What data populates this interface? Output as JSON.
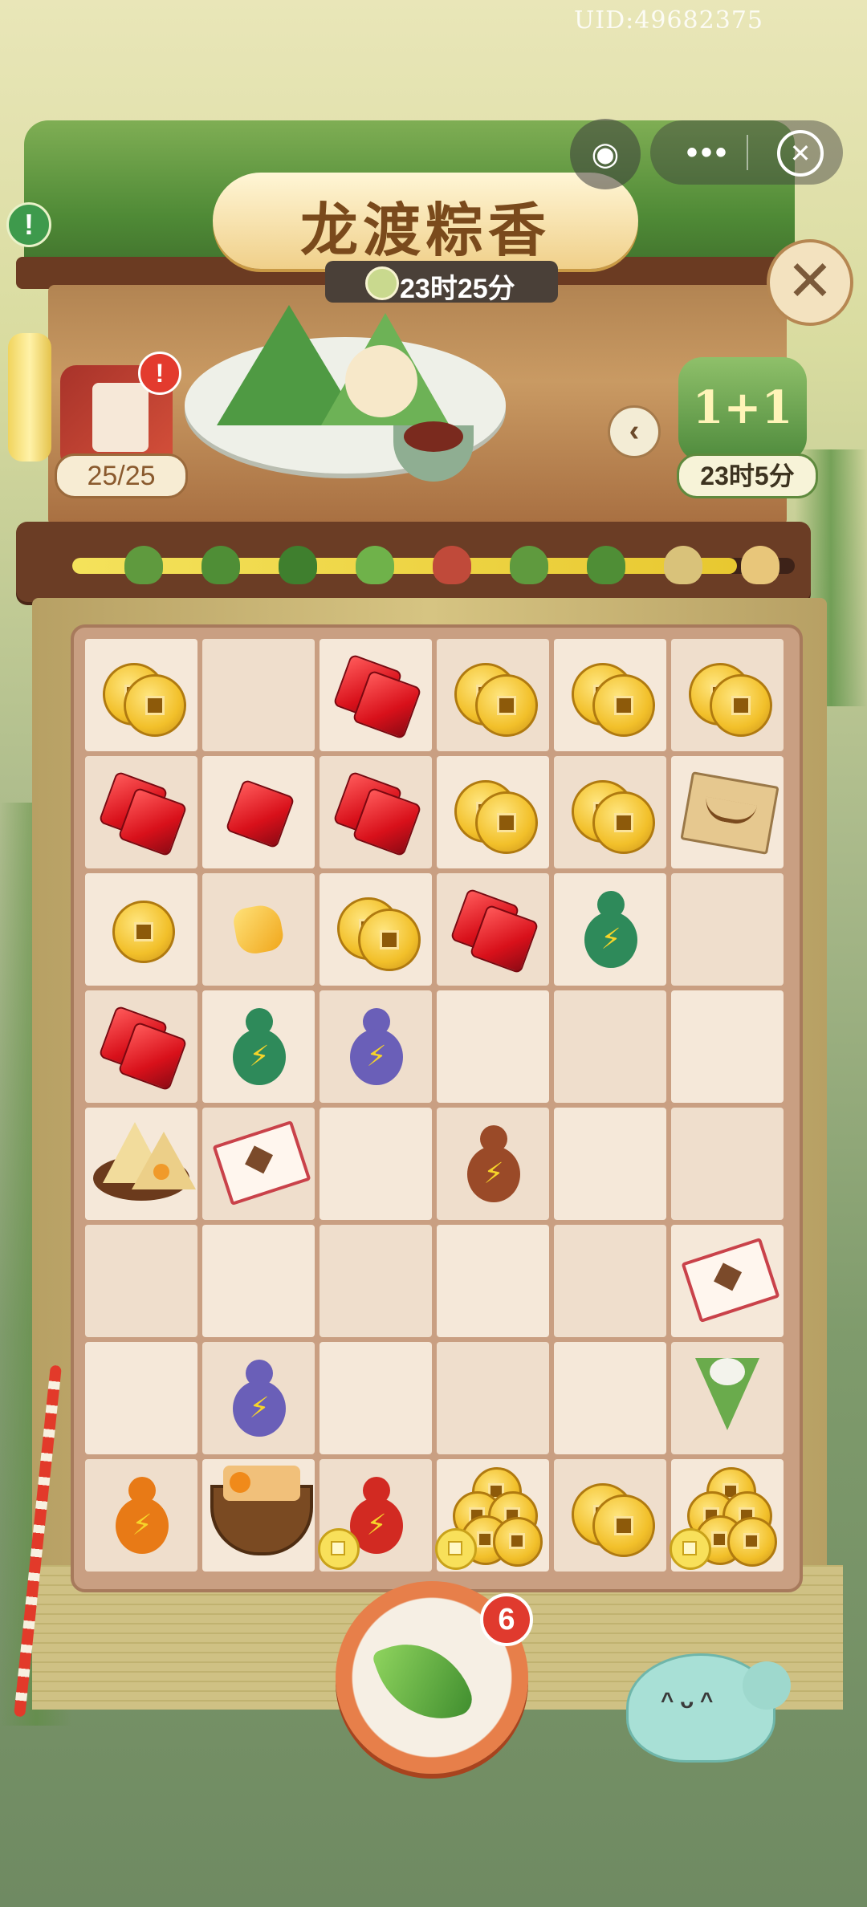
{
  "header": {
    "uid": "UID:49682375",
    "title": "龙渡粽香",
    "event_timer": "23时25分",
    "card_count": "25/25",
    "side_event_label": "1+1",
    "side_event_timer": "23时5分",
    "alert_badge": "!",
    "info_badge": "!"
  },
  "miniprogram": {
    "more_label": "•••",
    "close_label": "✕"
  },
  "progress": {
    "fill_fraction": 0.92,
    "stages": 9
  },
  "board": {
    "rows": 8,
    "cols": 6,
    "cells": [
      [
        "coins",
        "",
        "gems",
        "coins",
        "coins",
        "coins"
      ],
      [
        "gems",
        "gem",
        "gems",
        "coins",
        "coins",
        "map"
      ],
      [
        "coin",
        "gold",
        "coins",
        "gems",
        "gourd-green",
        ""
      ],
      [
        "gems",
        "gourd-green",
        "gourd-purple",
        "",
        "",
        ""
      ],
      [
        "zongzi-plate",
        "ticket",
        "",
        "gourd-brown",
        "",
        ""
      ],
      [
        "",
        "",
        "",
        "",
        "",
        "ticket"
      ],
      [
        "",
        "gourd-purple",
        "",
        "",
        "",
        "rice-cone"
      ],
      [
        "gourd-orange-chick",
        "basket",
        "gourd-red-chick",
        "coin-stack-chick",
        "coins",
        "coin-stack-chick"
      ]
    ]
  },
  "generator": {
    "count": "6"
  },
  "colors": {
    "accent_gold": "#f2c02a",
    "badge_red": "#e33b2e",
    "wood_brown": "#6b3d25"
  }
}
